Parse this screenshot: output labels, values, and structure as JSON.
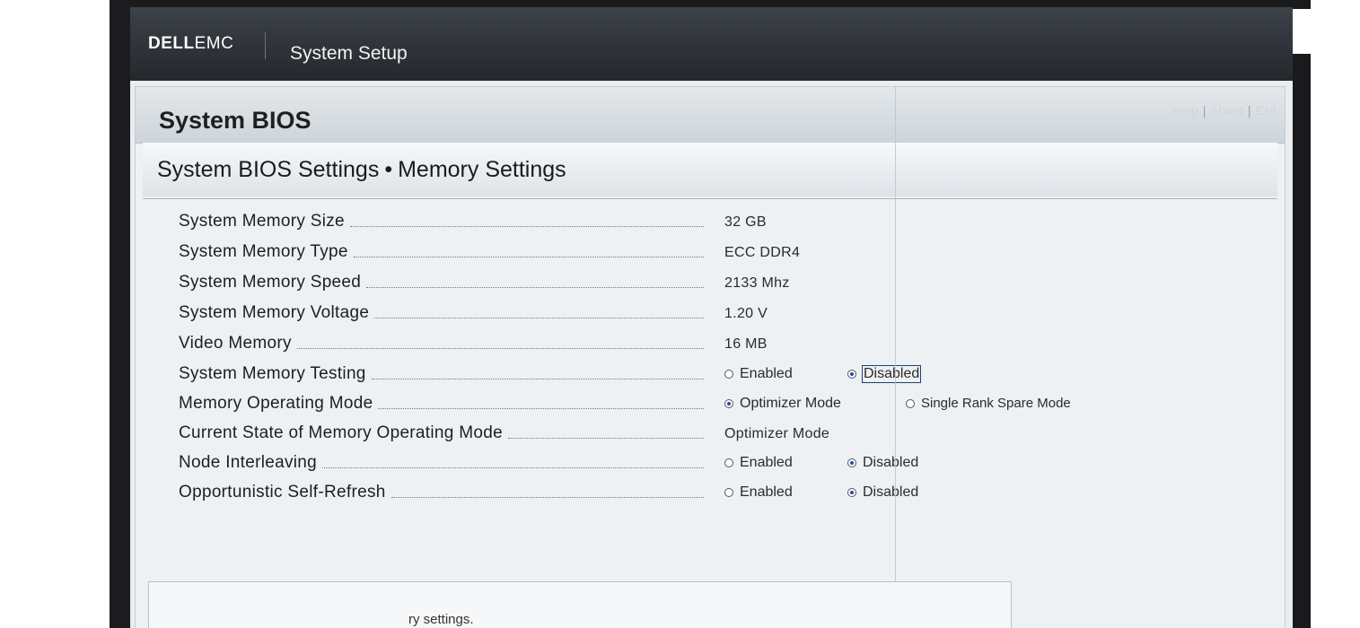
{
  "header": {
    "brand_dell": "DELL",
    "brand_emc": "EMC",
    "app_title": "System Setup",
    "help": "Help",
    "about": "About",
    "exit": "Exit",
    "separator": "|"
  },
  "panel": {
    "title": "System BIOS",
    "breadcrumb_parent": "System BIOS Settings",
    "breadcrumb_dot": "•",
    "breadcrumb_current": "Memory Settings"
  },
  "settings": [
    {
      "label": "System Memory Size",
      "value": "32 GB"
    },
    {
      "label": "System Memory Type",
      "value": "ECC DDR4"
    },
    {
      "label": "System Memory Speed",
      "value": "2133 Mhz"
    },
    {
      "label": "System Memory Voltage",
      "value": "1.20 V"
    },
    {
      "label": "Video Memory",
      "value": "16 MB"
    },
    {
      "label": "System Memory Testing",
      "options": [
        "Enabled",
        "Disabled"
      ],
      "selected": "Disabled"
    },
    {
      "label": "Memory Operating Mode",
      "options": [
        "Optimizer Mode",
        "Single Rank Spare Mode"
      ],
      "selected": "Optimizer Mode"
    },
    {
      "label": "Current State of Memory Operating Mode",
      "value": "Optimizer Mode"
    },
    {
      "label": "Node Interleaving",
      "options": [
        "Enabled",
        "Disabled"
      ],
      "selected": "Disabled"
    },
    {
      "label": "Opportunistic Self-Refresh",
      "options": [
        "Enabled",
        "Disabled"
      ],
      "selected": "Disabled"
    }
  ],
  "help_text": "ry settings.",
  "colors": {
    "topbar": "#2c3036",
    "radio_selected": "#1c4f9c",
    "panel_bg": "#eef1f3"
  }
}
